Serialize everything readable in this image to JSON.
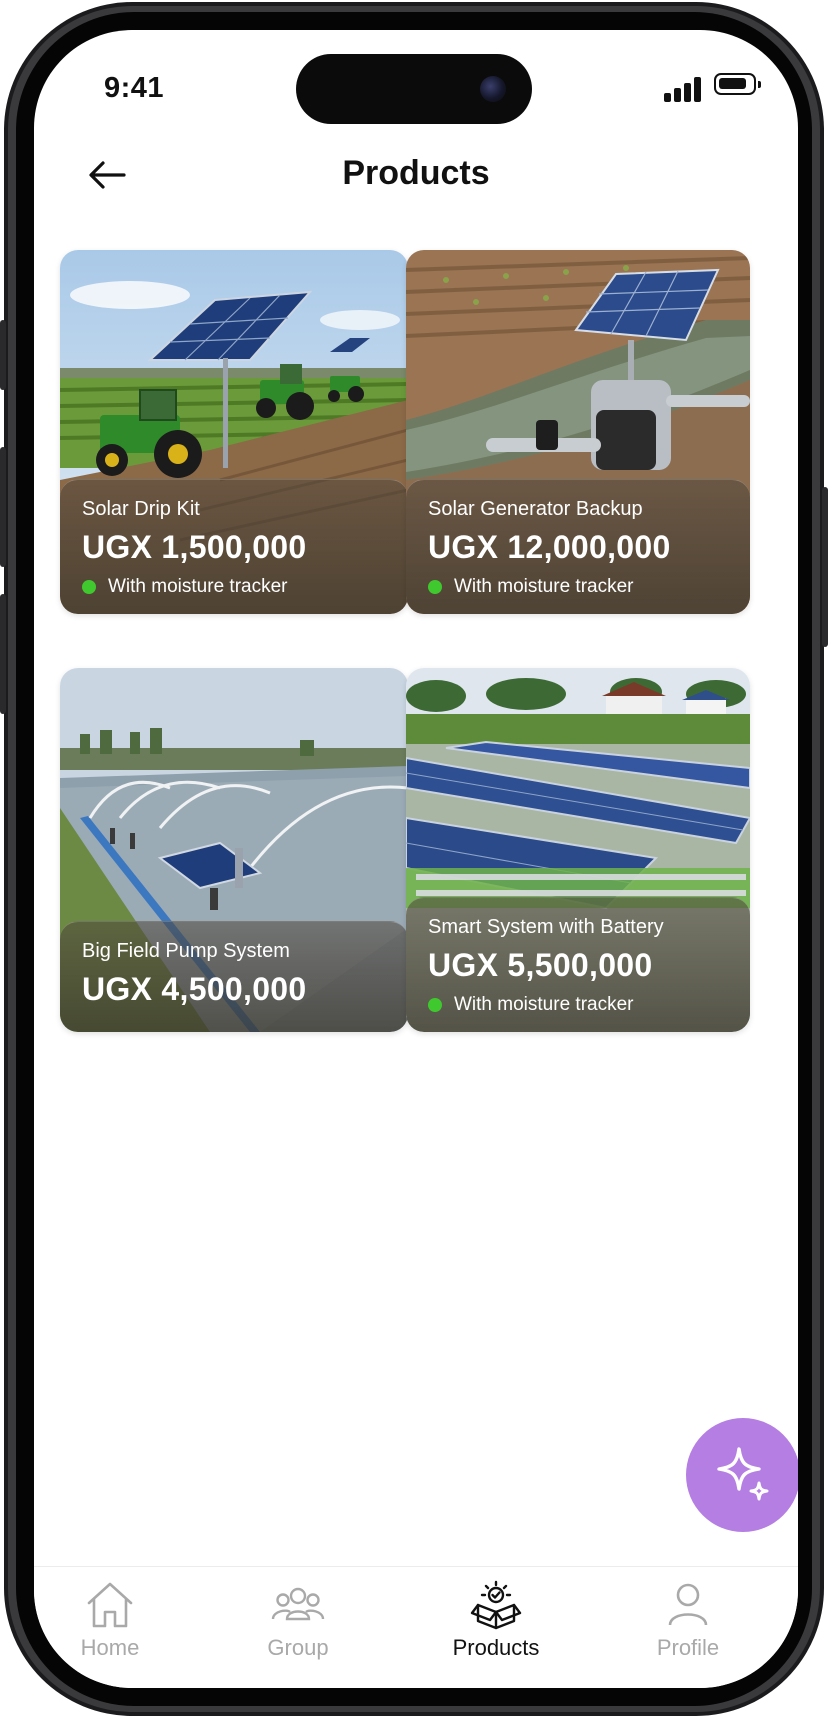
{
  "status_bar": {
    "time": "9:41"
  },
  "header": {
    "title": "Products"
  },
  "products": [
    {
      "name": "Solar Drip Kit",
      "price": "UGX 1,500,000",
      "tag": "With moisture tracker"
    },
    {
      "name": "Solar Generator Backup",
      "price": "UGX 12,000,000",
      "tag": "With moisture tracker"
    },
    {
      "name": "Big Field Pump System",
      "price": "UGX 4,500,000"
    },
    {
      "name": "Smart System with Battery",
      "price": "UGX 5,500,000",
      "tag": "With moisture tracker"
    }
  ],
  "tabs": {
    "home": "Home",
    "group": "Group",
    "products": "Products",
    "profile": "Profile"
  },
  "colors": {
    "accent": "#b57ee3",
    "indicator": "#3fc92e"
  },
  "icons": [
    "back-arrow-icon",
    "sparkle-icon",
    "home-icon",
    "group-icon",
    "products-box-icon",
    "profile-icon"
  ]
}
